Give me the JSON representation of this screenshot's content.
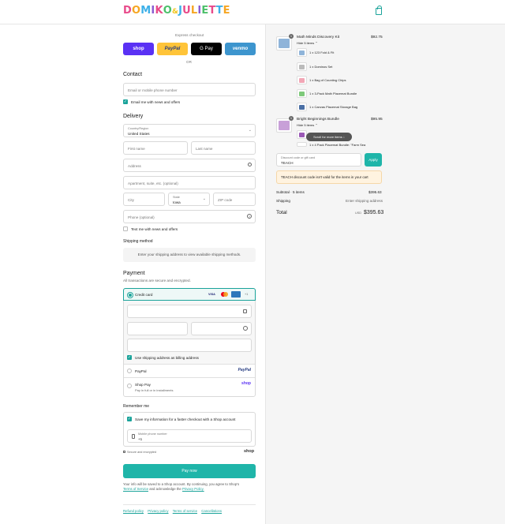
{
  "brand": {
    "logo_text": "DOMIKO & JULIETTE",
    "colors": {
      "accent": "#1aa39a",
      "pay_button": "#1fb5a9",
      "shop": "#5a31f4",
      "paypal": "#ffc439",
      "venmo": "#3d95ce",
      "error_bg": "#fff3e0"
    }
  },
  "express": {
    "label": "Express checkout",
    "shop": "shop",
    "paypal": "PayPal",
    "gpay": "G Pay",
    "venmo": "venmo",
    "or": "OR"
  },
  "contact": {
    "title": "Contact",
    "email_placeholder": "Email or mobile phone number",
    "news_label": "Email me with news and offers"
  },
  "delivery": {
    "title": "Delivery",
    "country_label": "Country/Region",
    "country_value": "United States",
    "first_name": "First name",
    "last_name": "Last name",
    "address": "Address",
    "apartment": "Apartment, suite, etc. (optional)",
    "city": "City",
    "state_label": "State",
    "state_value": "Iowa",
    "zip": "ZIP code",
    "phone": "Phone (optional)",
    "text_label": "Text me with news and offers"
  },
  "shipping": {
    "title": "Shipping method",
    "placeholder": "Enter your shipping address to view available shipping methods."
  },
  "payment": {
    "title": "Payment",
    "subtitle": "All transactions are secure and encrypted.",
    "credit_card": "Credit card",
    "cards": [
      "VISA",
      "MC",
      "AMEX",
      "+1"
    ],
    "billing_label": "Use shipping address as billing address",
    "paypal_label": "PayPal",
    "paypal_logo": "PayPal",
    "shoppay_label": "Shop Pay",
    "shoppay_sub": "Pay in full or in installments",
    "shoppay_logo": "shop"
  },
  "remember": {
    "title": "Remember me",
    "save_label": "Save my information for a faster checkout with a Shop account",
    "phone_label": "Mobile phone number",
    "phone_value": "+1",
    "secure": "Secure and encrypted",
    "shop_logo": "shop"
  },
  "pay_button": "Pay now",
  "legal": {
    "text": "Your info will be saved to a Shop account. By continuing, you agree to Shop's",
    "terms": "Terms of Service",
    "and": "and acknowledge the",
    "privacy": "Privacy Policy."
  },
  "footer": {
    "refund": "Refund policy",
    "privacy": "Privacy policy",
    "terms": "Terms of service",
    "cancel": "Cancellations"
  },
  "cart": {
    "items": [
      {
        "name": "Math Minds Discovery Kit",
        "price": "$92.75",
        "qty": "1",
        "toggle": "Hide 5 items",
        "subs": [
          "1 x 123 Fold & Fit",
          "1 x Dominos Set",
          "1 x Bag of Counting Chips",
          "1 x 3-Pack Math Placemat Bundle",
          "1 x Canvas Placemat Storage Bag"
        ]
      },
      {
        "name": "Bright Beginnings Bundle",
        "price": "$95.95",
        "qty": "1",
        "toggle": "Hide 5 items",
        "subs": [
          "1 x 4 Pack Placemat Bundle: \"Farm Sea"
        ]
      }
    ],
    "scroll_hint": "Scroll for more items",
    "discount_label": "Discount code or gift card",
    "discount_value": "TEACH",
    "apply": "Apply",
    "error": "TEACH discount code isn't valid for the items in your cart",
    "subtotal_label": "Subtotal · 5 items",
    "subtotal": "$395.63",
    "shipping_label": "Shipping",
    "shipping_value": "Enter shipping address",
    "total_label": "Total",
    "currency": "USD",
    "total": "$395.63"
  }
}
